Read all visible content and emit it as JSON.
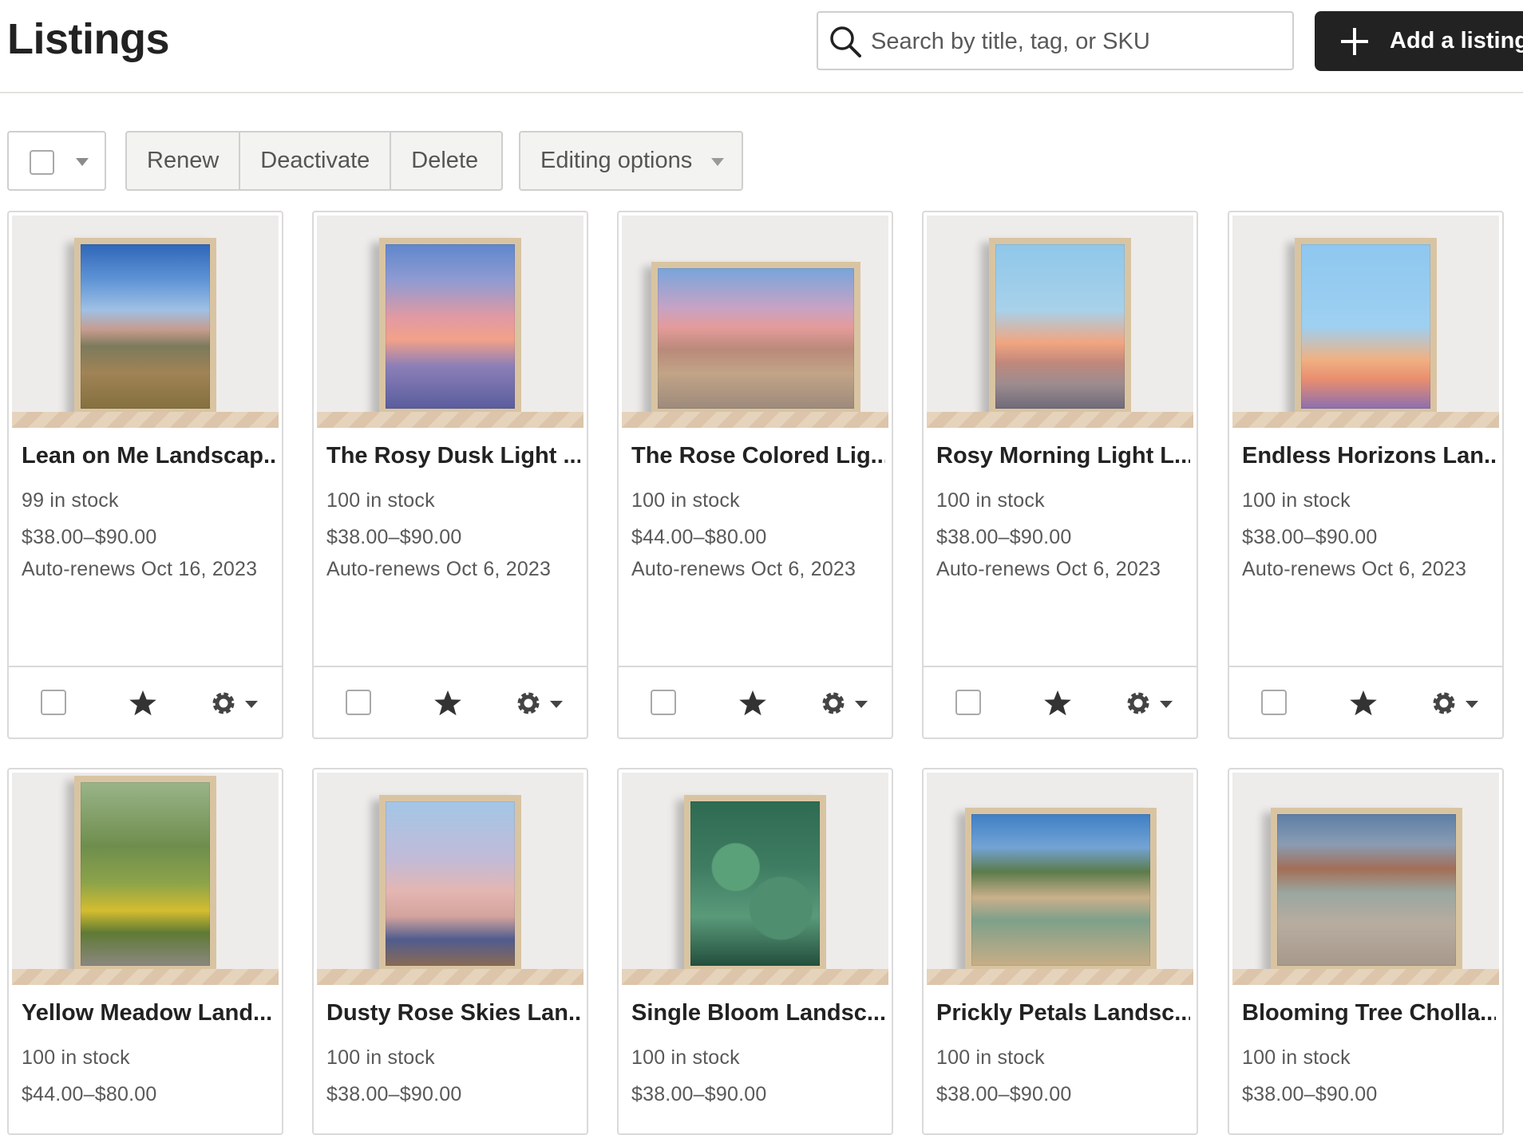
{
  "header": {
    "title": "Listings",
    "search_placeholder": "Search by title, tag, or SKU",
    "add_label": "Add a listing"
  },
  "toolbar": {
    "renew": "Renew",
    "deactivate": "Deactivate",
    "delete": "Delete",
    "editing_options": "Editing options"
  },
  "listings": [
    {
      "title": "Lean on Me Landscap...",
      "stock": "99 in stock",
      "price": "$38.00–$90.00",
      "renews": "Auto-renews Oct 16, 2023"
    },
    {
      "title": "The Rosy Dusk Light ...",
      "stock": "100 in stock",
      "price": "$38.00–$90.00",
      "renews": "Auto-renews Oct 6, 2023"
    },
    {
      "title": "The Rose Colored Lig...",
      "stock": "100 in stock",
      "price": "$44.00–$80.00",
      "renews": "Auto-renews Oct 6, 2023"
    },
    {
      "title": "Rosy Morning Light L...",
      "stock": "100 in stock",
      "price": "$38.00–$90.00",
      "renews": "Auto-renews Oct 6, 2023"
    },
    {
      "title": "Endless Horizons Lan...",
      "stock": "100 in stock",
      "price": "$38.00–$90.00",
      "renews": "Auto-renews Oct 6, 2023"
    },
    {
      "title": "Yellow Meadow Land...",
      "stock": "100 in stock",
      "price": "$44.00–$80.00",
      "renews": ""
    },
    {
      "title": "Dusty Rose Skies Lan...",
      "stock": "100 in stock",
      "price": "$38.00–$90.00",
      "renews": ""
    },
    {
      "title": "Single Bloom Landsc...",
      "stock": "100 in stock",
      "price": "$38.00–$90.00",
      "renews": ""
    },
    {
      "title": "Prickly Petals Landsc...",
      "stock": "100 in stock",
      "price": "$38.00–$90.00",
      "renews": ""
    },
    {
      "title": "Blooming Tree Cholla...",
      "stock": "100 in stock",
      "price": "$38.00–$90.00",
      "renews": ""
    }
  ],
  "colors": {
    "primary_button": "#222222",
    "border": "#cfcfcf",
    "muted_text": "#595959"
  }
}
